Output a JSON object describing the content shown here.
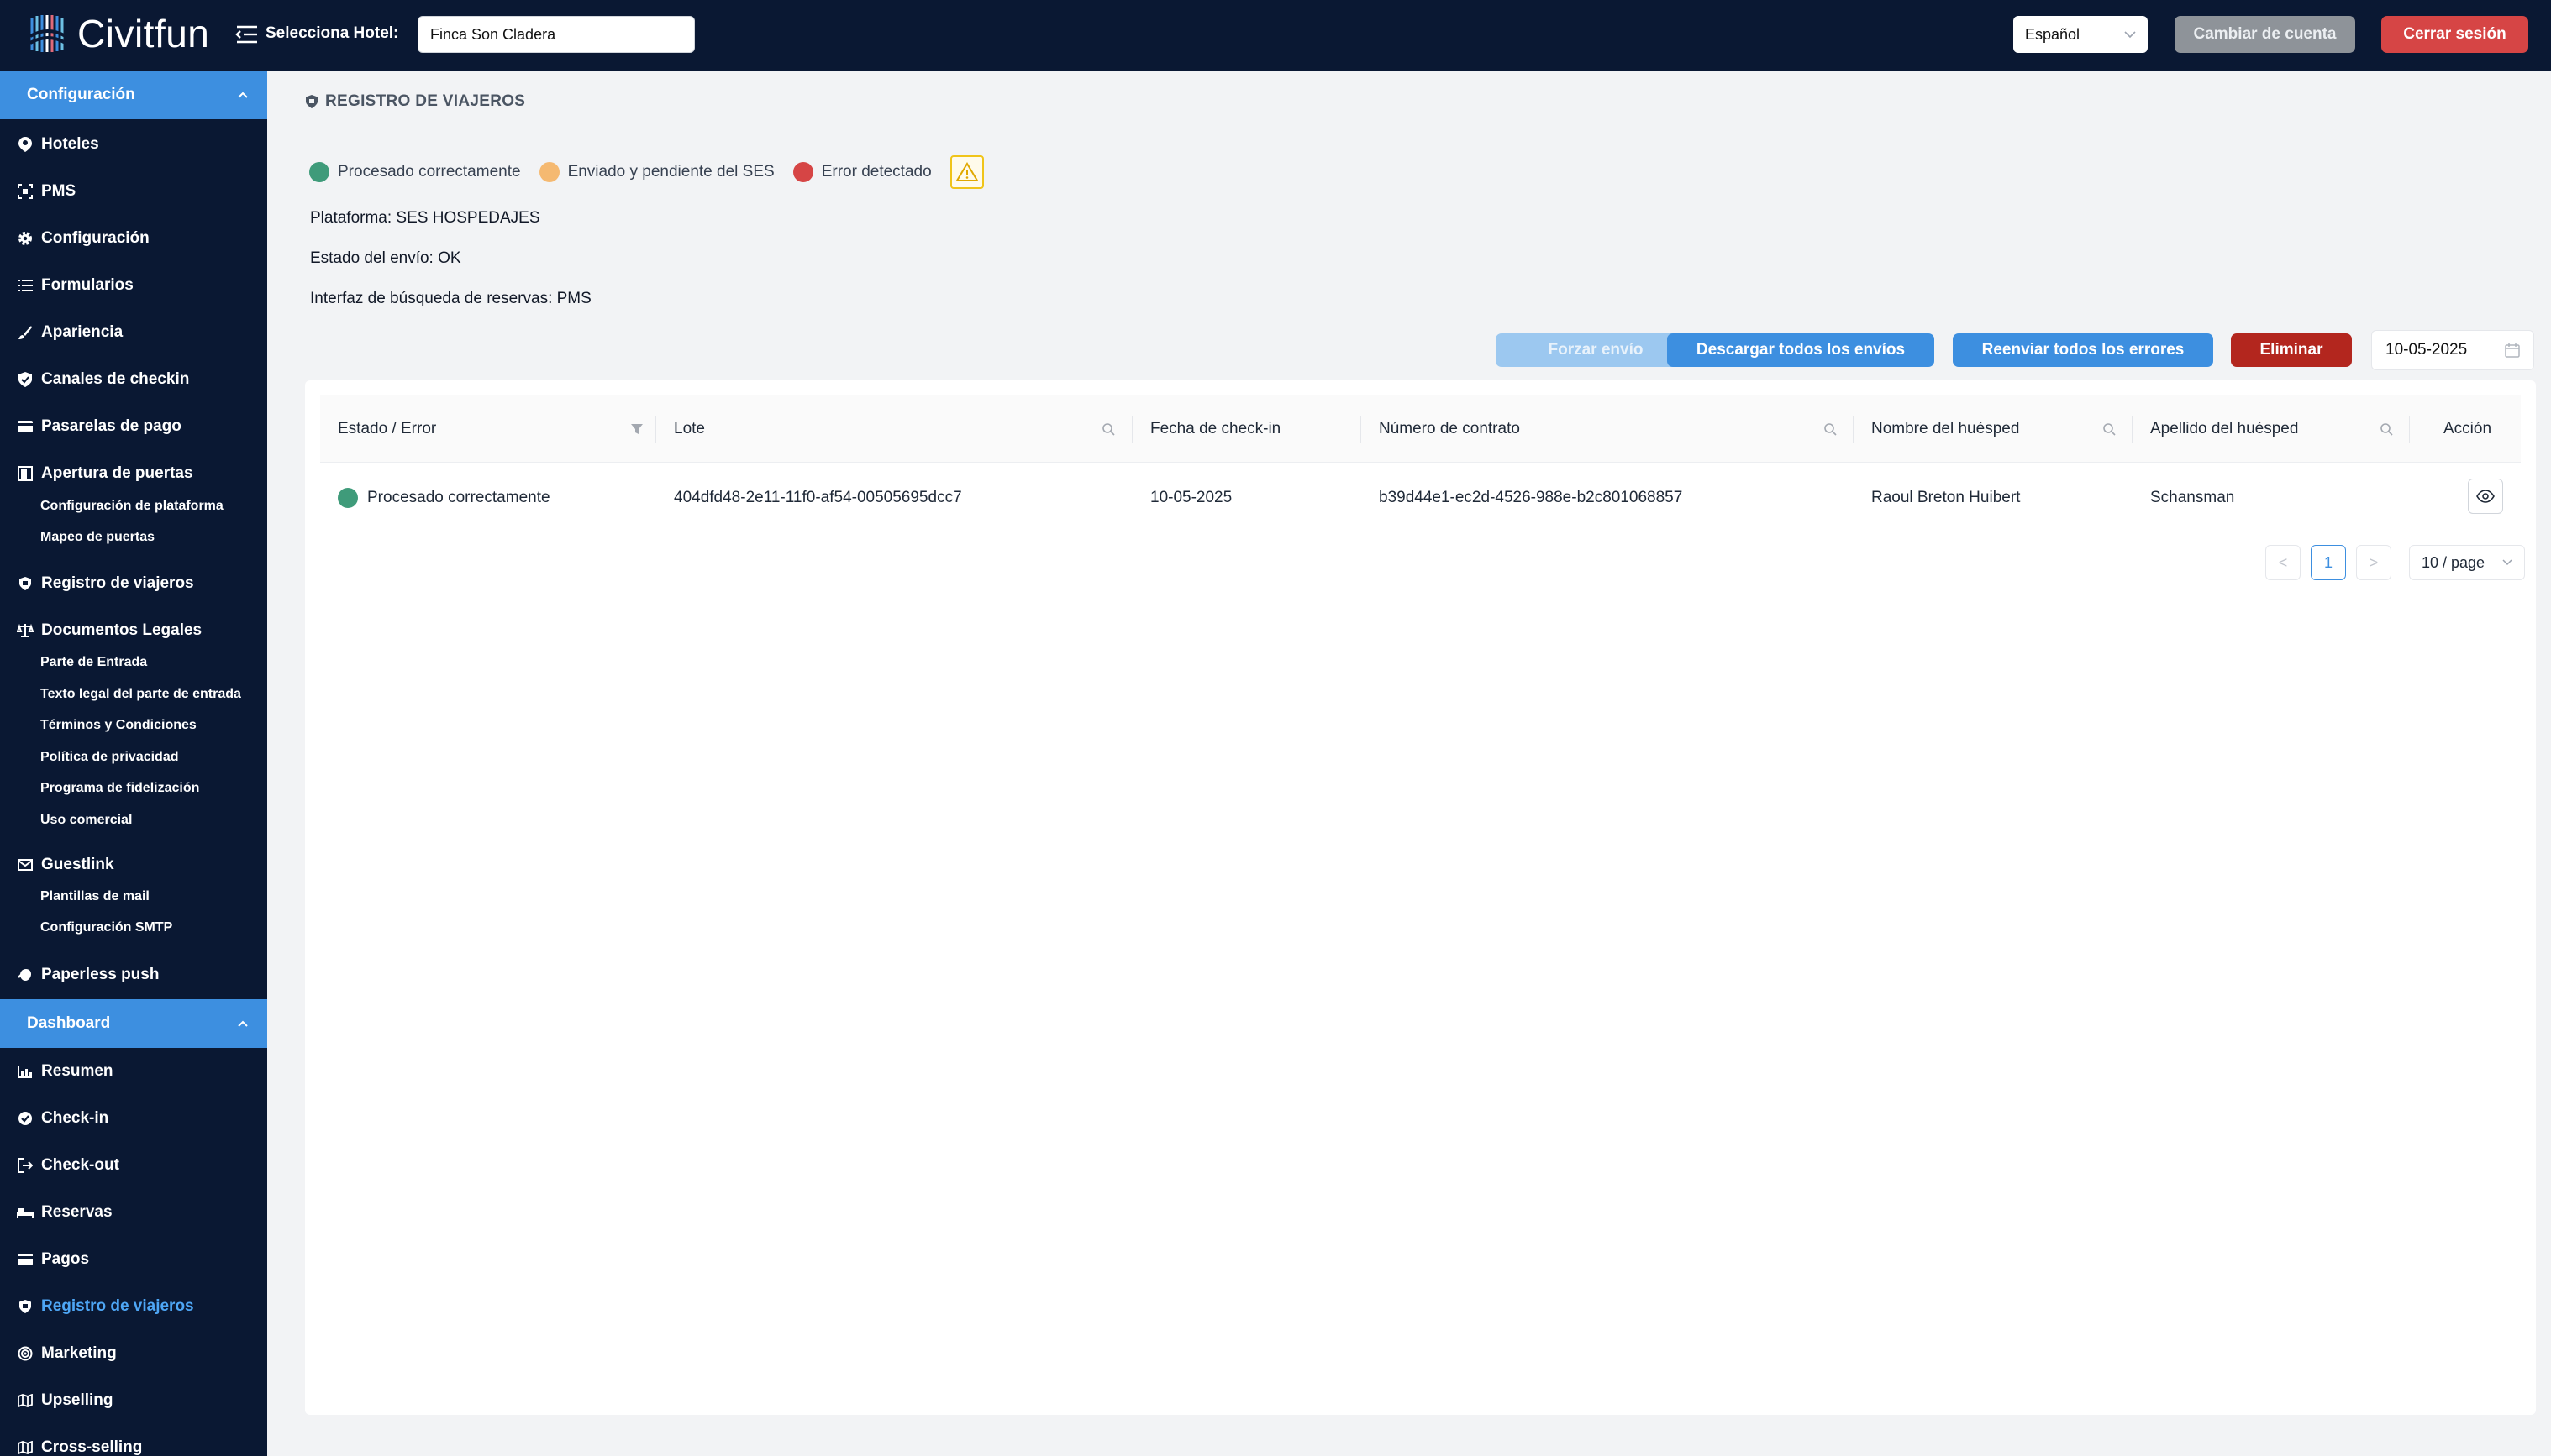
{
  "header": {
    "app_name": "Civitfun",
    "hotel_label": "Selecciona Hotel:",
    "hotel_value": "Finca Son Cladera",
    "language": "Español",
    "switch_account": "Cambiar de cuenta",
    "logout": "Cerrar sesión"
  },
  "sidebar": {
    "config_header": "Configuración",
    "config_items": [
      {
        "label": "Hoteles",
        "icon": "map-pin-icon"
      },
      {
        "label": "PMS",
        "icon": "pms-icon"
      },
      {
        "label": "Configuración",
        "icon": "gear-icon"
      },
      {
        "label": "Formularios",
        "icon": "list-icon"
      },
      {
        "label": "Apariencia",
        "icon": "brush-icon"
      },
      {
        "label": "Canales de checkin",
        "icon": "shield-check-icon"
      },
      {
        "label": "Pasarelas de pago",
        "icon": "card-icon"
      },
      {
        "label": "Apertura de puertas",
        "icon": "door-icon"
      }
    ],
    "doors_sub": [
      "Configuración de plataforma",
      "Mapeo de puertas"
    ],
    "travelers": "Registro de viajeros",
    "legal": "Documentos Legales",
    "legal_sub": [
      "Parte de Entrada",
      "Texto legal del parte de entrada",
      "Términos y Condiciones",
      "Política de privacidad",
      "Programa de fidelización",
      "Uso comercial"
    ],
    "guestlink": "Guestlink",
    "guestlink_sub": [
      "Plantillas de mail",
      "Configuración SMTP"
    ],
    "paperless": "Paperless push",
    "dashboard_header": "Dashboard",
    "dashboard_items": [
      {
        "label": "Resumen",
        "icon": "bar-chart-icon"
      },
      {
        "label": "Check-in",
        "icon": "check-circle-icon"
      },
      {
        "label": "Check-out",
        "icon": "logout-arrow-icon"
      },
      {
        "label": "Reservas",
        "icon": "bed-icon"
      },
      {
        "label": "Pagos",
        "icon": "card-icon"
      },
      {
        "label": "Registro de viajeros",
        "icon": "shield-icon"
      },
      {
        "label": "Marketing",
        "icon": "target-icon"
      },
      {
        "label": "Upselling",
        "icon": "map-icon"
      },
      {
        "label": "Cross-selling",
        "icon": "map-icon"
      }
    ]
  },
  "main": {
    "title": "REGISTRO DE VIAJEROS",
    "legend": [
      {
        "label": "Procesado correctamente",
        "color": "#3f9b7a"
      },
      {
        "label": "Enviado y pendiente del SES",
        "color": "#f5b971"
      },
      {
        "label": "Error detectado",
        "color": "#d64545"
      }
    ],
    "platform": "Plataforma: SES HOSPEDAJES",
    "send_status": "Estado del envío: OK",
    "search_interface": "Interfaz de búsqueda de reservas: PMS",
    "buttons": {
      "force": "Forzar envío",
      "download": "Descargar todos los envíos",
      "resend": "Reenviar todos los errores",
      "delete": "Eliminar"
    },
    "date": "10-05-2025",
    "table": {
      "headers": [
        "Estado / Error",
        "Lote",
        "Fecha de check-in",
        "Número de contrato",
        "Nombre del huésped",
        "Apellido del huésped",
        "Acción"
      ],
      "rows": [
        {
          "status": "Procesado correctamente",
          "batch": "404dfd48-2e11-11f0-af54-00505695dcc7",
          "checkin": "10-05-2025",
          "contract": "b39d44e1-ec2d-4526-988e-b2c801068857",
          "first_name": "Raoul Breton Huibert",
          "last_name": "Schansman"
        }
      ]
    },
    "pagination": {
      "prev": "<",
      "page": "1",
      "next": ">",
      "page_size": "10 / page"
    }
  }
}
